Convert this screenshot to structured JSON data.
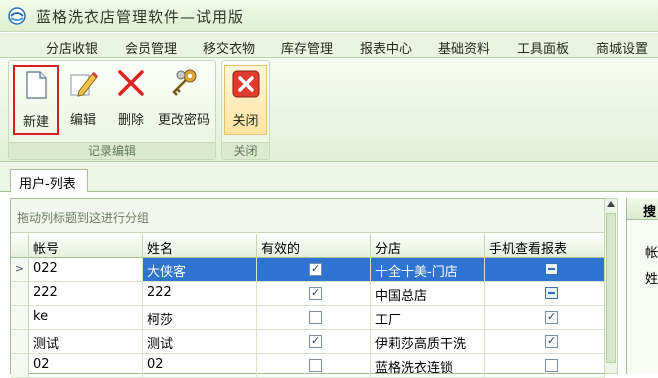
{
  "title": "蓝格洗衣店管理软件—试用版",
  "menu": [
    "分店收银",
    "会员管理",
    "移交衣物",
    "库存管理",
    "报表中心",
    "基础资料",
    "工具面板",
    "商城设置"
  ],
  "ribbon": {
    "buttons": [
      {
        "label": "新建",
        "icon": "new-document-icon"
      },
      {
        "label": "编辑",
        "icon": "edit-pencil-icon"
      },
      {
        "label": "删除",
        "icon": "delete-x-icon"
      },
      {
        "label": "更改密码",
        "icon": "keys-icon"
      },
      {
        "label": "关闭",
        "icon": "close-icon"
      }
    ],
    "groups": [
      "记录编辑",
      "关闭"
    ]
  },
  "tab": "用户-列表",
  "grid": {
    "group_hint": "拖动列标题到这进行分组",
    "columns": [
      "帐号",
      "姓名",
      "有效的",
      "分店",
      "手机查看报表"
    ],
    "rows": [
      {
        "account": "022",
        "name": "大侠客",
        "valid": true,
        "branch": "十全十美-门店",
        "phone_report": true
      },
      {
        "account": "222",
        "name": "222",
        "valid": true,
        "branch": "中国总店",
        "phone_report": true
      },
      {
        "account": "ke",
        "name": "柯莎",
        "valid": false,
        "branch": "工厂",
        "phone_report": true
      },
      {
        "account": "测试",
        "name": "测试",
        "valid": true,
        "branch": "伊莉莎高质干洗",
        "phone_report": true
      },
      {
        "account": "02",
        "name": "02",
        "valid": false,
        "branch": "蓝格洗衣连锁",
        "phone_report": false
      }
    ],
    "active_row_indicator": ">"
  },
  "right_panel": {
    "header": "搜",
    "labels": [
      "帐",
      "姓"
    ]
  },
  "colors": {
    "accent": "#2e74d0",
    "highlight": "#d81e1e",
    "ribbon": "#e3efd7"
  }
}
